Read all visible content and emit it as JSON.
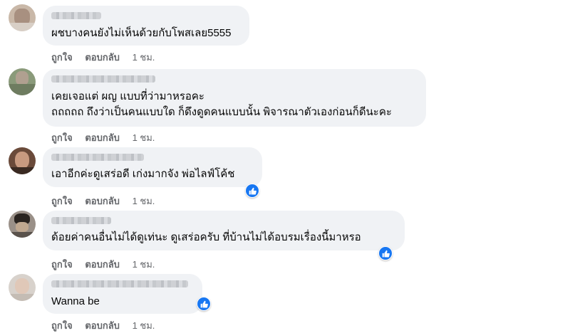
{
  "comments": [
    {
      "text_lines": [
        "ผชบางคนยังไม่เห็นด้วยกับโพสเลย5555"
      ],
      "like_label": "ถูกใจ",
      "reply_label": "ตอบกลับ",
      "time": "1 ชม.",
      "has_reaction": false
    },
    {
      "text_lines": [
        "เคยเจอแต่ ผญ แบบที่ว่ามาหรอคะ",
        "ถถถถถ ถึงว่าเป็นคนแบบใด ก็ดึงดูดคนแบบนั้น พิจารณาตัวเองก่อนก็ดีนะคะ"
      ],
      "like_label": "ถูกใจ",
      "reply_label": "ตอบกลับ",
      "time": "1 ชม.",
      "has_reaction": false
    },
    {
      "text_lines": [
        "เอาอีกค่ะดูเสร่อดี เก่งมากจัง พ่อไลฟ์โค้ช"
      ],
      "like_label": "ถูกใจ",
      "reply_label": "ตอบกลับ",
      "time": "1 ชม.",
      "has_reaction": true
    },
    {
      "text_lines": [
        "ด้อยค่าคนอื่นไม่ได้ดูเท่นะ ดูเสร่อครับ ที่บ้านไม่ได้อบรมเรื่องนี้มาหรอ"
      ],
      "like_label": "ถูกใจ",
      "reply_label": "ตอบกลับ",
      "time": "1 ชม.",
      "has_reaction": true
    },
    {
      "text_lines": [
        "Wanna be"
      ],
      "like_label": "ถูกใจ",
      "reply_label": "ตอบกลับ",
      "time": "1 ชม.",
      "has_reaction": true
    }
  ],
  "colors": {
    "bubble": "#f0f2f5",
    "meta_text": "#65676b",
    "reaction_blue": "#1877f2"
  },
  "icons": {
    "reaction": "thumbs-up-icon"
  }
}
